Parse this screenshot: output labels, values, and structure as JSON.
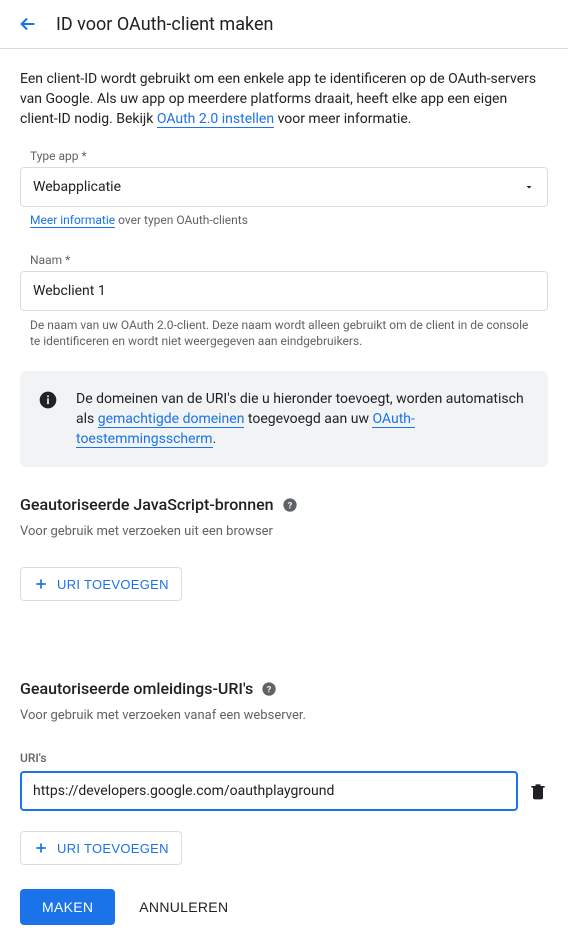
{
  "header": {
    "title": "ID voor OAuth-client maken"
  },
  "intro": {
    "text_before": "Een client-ID wordt gebruikt om een enkele app te identificeren op de OAuth-servers van Google. Als uw app op meerdere platforms draait, heeft elke app een eigen client-ID nodig. Bekijk ",
    "link": "OAuth 2.0 instellen",
    "text_after": " voor meer informatie."
  },
  "app_type": {
    "label": "Type app *",
    "value": "Webapplicatie",
    "help_link": "Meer informatie",
    "help_after": " over typen OAuth-clients"
  },
  "name": {
    "label": "Naam *",
    "value": "Webclient 1",
    "hint": "De naam van uw OAuth 2.0-client. Deze naam wordt alleen gebruikt om de client in de console te identificeren en wordt niet weergegeven aan eindgebruikers."
  },
  "info": {
    "text_before": "De domeinen van de URI's die u hieronder toevoegt, worden automatisch als ",
    "link1": "gemachtigde domeinen",
    "text_mid": " toegevoegd aan uw ",
    "link2": "OAuth-toestemmingsscherm",
    "text_after": "."
  },
  "js_origins": {
    "title": "Geautoriseerde JavaScript-bronnen",
    "desc": "Voor gebruik met verzoeken uit een browser",
    "add_label": "URI TOEVOEGEN"
  },
  "redirect": {
    "title": "Geautoriseerde omleidings-URI's",
    "desc": "Voor gebruik met verzoeken vanaf een webserver.",
    "uris_label": "URI's",
    "uri_value": "https://developers.google.com/oauthplayground",
    "add_label": "URI TOEVOEGEN"
  },
  "actions": {
    "create": "MAKEN",
    "cancel": "ANNULEREN"
  }
}
